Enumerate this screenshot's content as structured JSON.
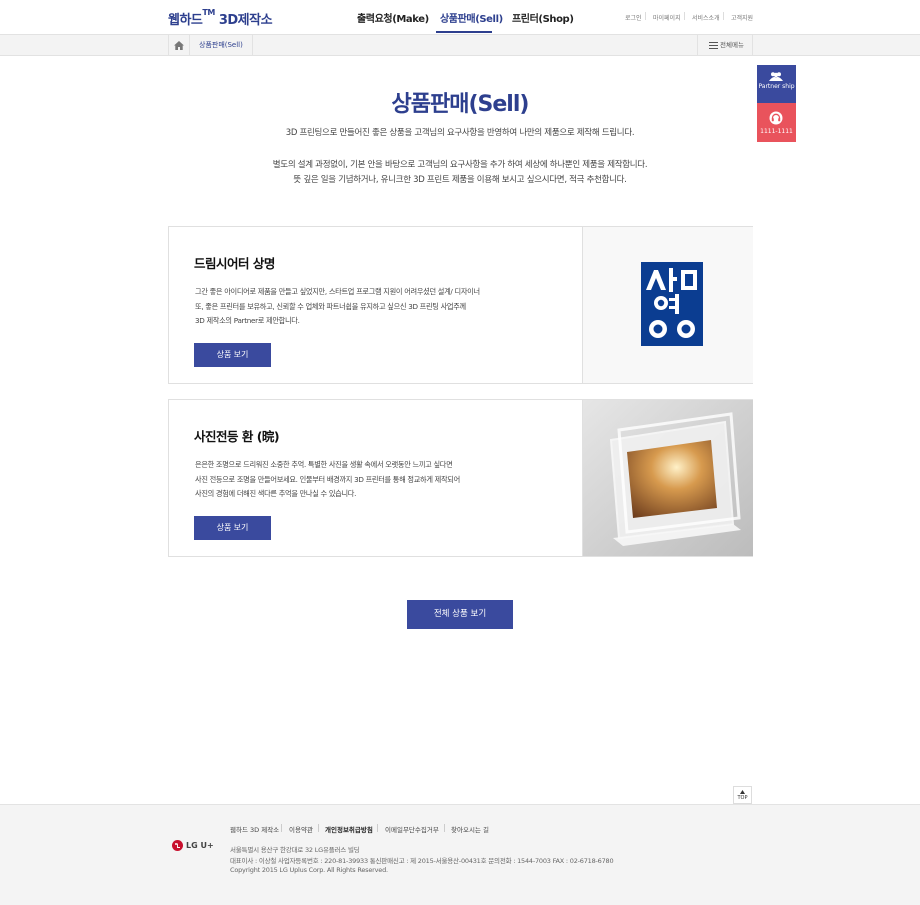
{
  "header": {
    "logo": "웹하드",
    "logo_tm": "TM",
    "logo_suffix": "3D제작소",
    "nav": [
      "출력요청(Make)",
      "상품판매(Sell)",
      "프린터(Shop)"
    ],
    "util": [
      "로그인",
      "마이페이지",
      "서비스소개",
      "고객지원"
    ]
  },
  "location": {
    "home_icon": "home-icon",
    "current": "상품판매(Sell)",
    "all_menu": "전체메뉴"
  },
  "quick": {
    "partner": "Partner ship",
    "partner_icon": "people-icon",
    "phone": "1111-1111",
    "phone_icon": "headset-icon"
  },
  "main": {
    "title": "상품판매(Sell)",
    "intro1": "3D 프린팅으로 만들어진 좋은 상품을 고객님의 요구사항을 반영하여  나만의 제품으로 제작해 드립니다.",
    "intro2": "별도의 설계 과정없이, 기본 안을 바탕으로 고객님의 요구사항을 추가 하여  세상에 하나뿐인 제품을 제작합니다.",
    "intro3": "뜻 깊은 일을 기념하거나, 유니크한 3D 프린트 제품을 이용해 보시고 싶으시다면, 적극 추천합니다."
  },
  "products": [
    {
      "title": "드림시어터 상명",
      "desc1": "그간 좋은 아이디어로 제품을 만들고 싶었지만, 스타트업 프로그램 지원이 어려우셨던 설계/ 디자이너",
      "desc2": "또, 좋은 프린터를 보유하고, 신뢰할 수 업체와 파트너쉽을 유지하고 싶으신 3D 프린팅 사업주께",
      "desc3": "3D 제작소의 Partner로 제안합니다.",
      "button": "상품 보기",
      "image_text": "상명"
    },
    {
      "title": "사진전등 환 (晥)",
      "desc1": "은은한 조명으로 드리워진 소중한 추억. 특별한 사진을 생활 속에서 오랫동안 느끼고 싶다면",
      "desc2": "사진 전등으로 조명을 만들어보세요. 인물부터 배경까지 3D 프린터를 통해 정교하게 제작되어",
      "desc3": "사진의 경험에 더해진 색다른 추억을 만나실 수 있습니다.",
      "button": "상품 보기",
      "image_text": ""
    }
  ],
  "all_button": "전체 상품 보기",
  "top_button": "TOP",
  "footer": {
    "logo_text": "LG U+",
    "links": [
      "웹하드 3D 제작소",
      "이용약관",
      "개인정보취급방침",
      "이메일무단수집거부",
      "찾아오시는 길"
    ],
    "address": "서울특별시 용산구 한강대로 32 LG유플러스 빌딩",
    "info": "대표이사 : 이상철    사업자등록번호 : 220-81-39933    통신판매신고 : 제 2015-서울용산-00431호    문의전화 : 1544-7003    FAX : 02-6718-6780",
    "copyright": "Copyright 2015 LG Uplus Corp. All Rights Reserved."
  },
  "colors": {
    "brand": "#2d3f8e",
    "button": "#3a4a9e",
    "quick_red": "#e9535c"
  }
}
